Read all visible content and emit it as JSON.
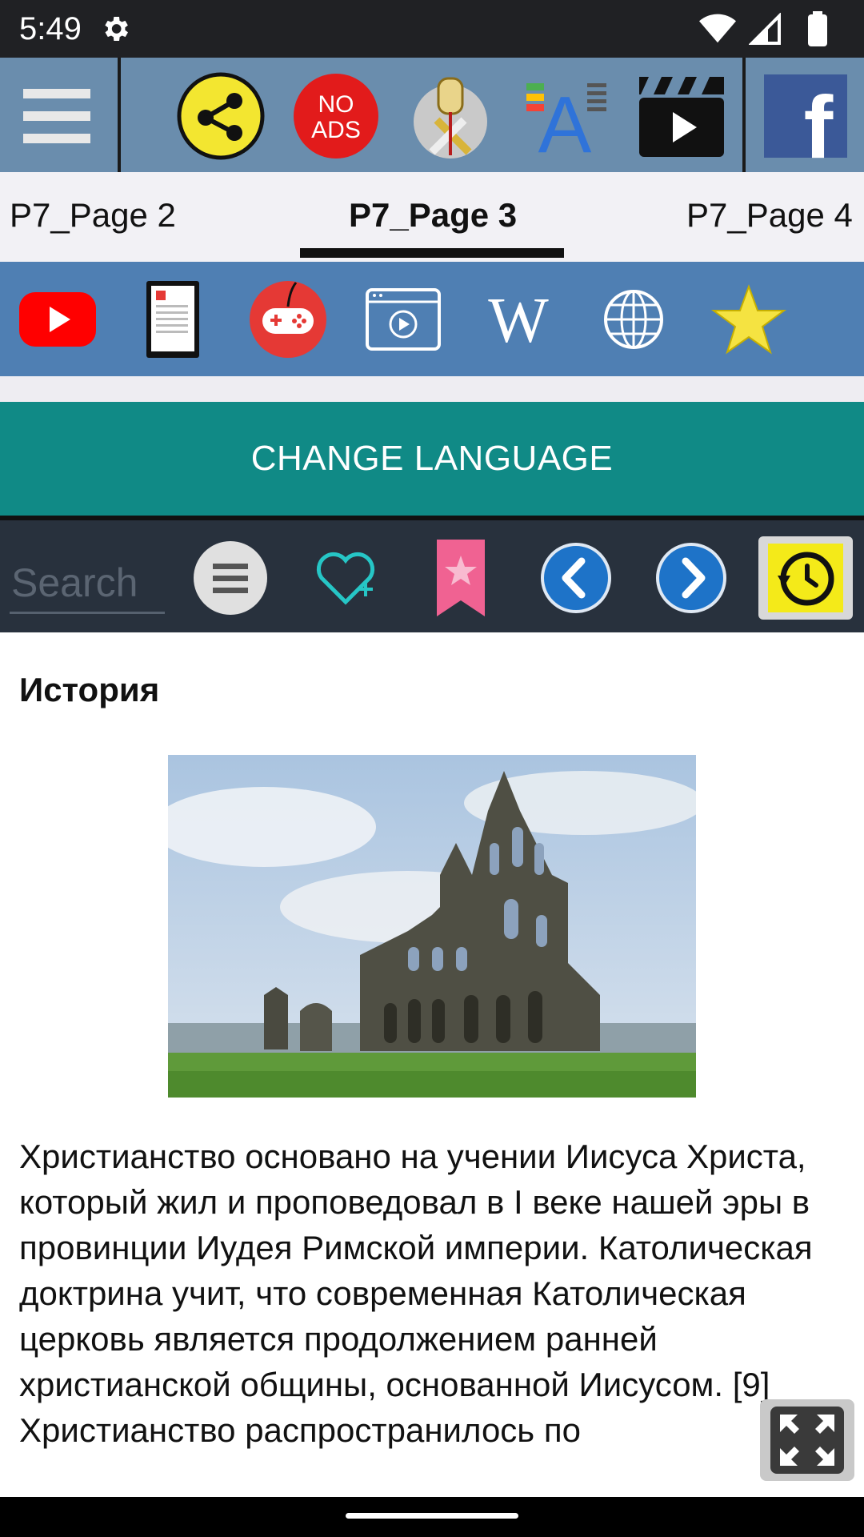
{
  "status_bar": {
    "time": "5:49"
  },
  "toolbar": {
    "items": [
      {
        "name": "menu-icon"
      },
      {
        "name": "share-icon"
      },
      {
        "name": "no-ads-icon",
        "label_line1": "NO",
        "label_line2": "ADS"
      },
      {
        "name": "vatican-emblem-icon"
      },
      {
        "name": "font-size-icon",
        "label": "A"
      },
      {
        "name": "video-clapper-icon"
      },
      {
        "name": "facebook-icon",
        "label": "f"
      }
    ]
  },
  "tabs": [
    {
      "label": "P7_Page 2",
      "active": false
    },
    {
      "label": "P7_Page 3",
      "active": true
    },
    {
      "label": "P7_Page 4",
      "active": false
    }
  ],
  "icon_bar": {
    "items": [
      {
        "name": "youtube-icon"
      },
      {
        "name": "ebook-icon"
      },
      {
        "name": "gamepad-icon"
      },
      {
        "name": "video-player-icon"
      },
      {
        "name": "wikipedia-icon",
        "label": "W"
      },
      {
        "name": "globe-icon"
      },
      {
        "name": "star-icon"
      }
    ]
  },
  "change_language_label": "CHANGE LANGUAGE",
  "search": {
    "placeholder": "Search"
  },
  "action_bar": {
    "items": [
      {
        "name": "list-menu-icon"
      },
      {
        "name": "add-favorite-icon"
      },
      {
        "name": "bookmark-icon"
      },
      {
        "name": "previous-icon"
      },
      {
        "name": "next-icon"
      },
      {
        "name": "history-icon"
      }
    ]
  },
  "article": {
    "heading": "История",
    "image": "abbey-ruins-photo",
    "paragraph": "Христианство основано на учении Иисуса Христа, который жил и проповедовал в I веке нашей эры в провинции Иудея Римской империи. Католическая доктрина учит, что современная Католическая церковь является продолжением ранней христианской общины, основанной Иисусом. [9] Христианство распространилось по"
  },
  "colors": {
    "toolbar": "#6a8dad",
    "icon_bar": "#4f7fb3",
    "change_language": "#108a86",
    "search_bar": "#28313d"
  }
}
